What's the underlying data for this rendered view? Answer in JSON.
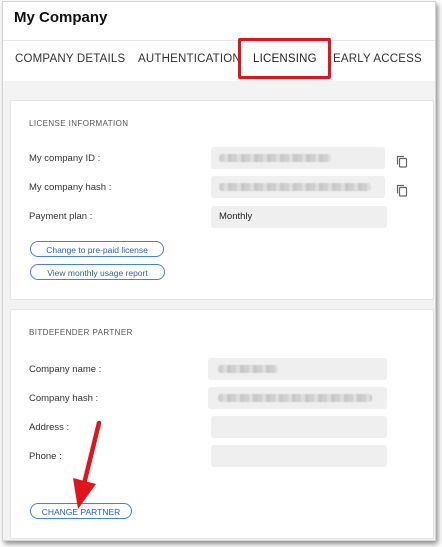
{
  "header": {
    "title": "My Company"
  },
  "tabs": [
    {
      "label": "COMPANY DETAILS"
    },
    {
      "label": "AUTHENTICATION"
    },
    {
      "label": "LICENSING"
    },
    {
      "label": "EARLY ACCESS"
    }
  ],
  "license_info": {
    "section_title": "LICENSE INFORMATION",
    "company_id_label": "My company ID :",
    "company_hash_label": "My company hash :",
    "payment_plan_label": "Payment plan :",
    "payment_plan_value": "Monthly",
    "prepaid_button": "Change to pre-paid license",
    "usage_report_button": "View monthly usage report"
  },
  "partner": {
    "section_title": "BITDEFENDER PARTNER",
    "company_name_label": "Company name :",
    "company_hash_label": "Company hash :",
    "address_label": "Address :",
    "phone_label": "Phone :",
    "change_partner_button": "CHANGE PARTNER"
  },
  "colors": {
    "highlight": "#e0141a",
    "accent": "#2a6ed8",
    "arrow": "#e0141a"
  },
  "icons": {
    "copy": "copy-icon",
    "arrow": "red-arrow-annotation"
  }
}
